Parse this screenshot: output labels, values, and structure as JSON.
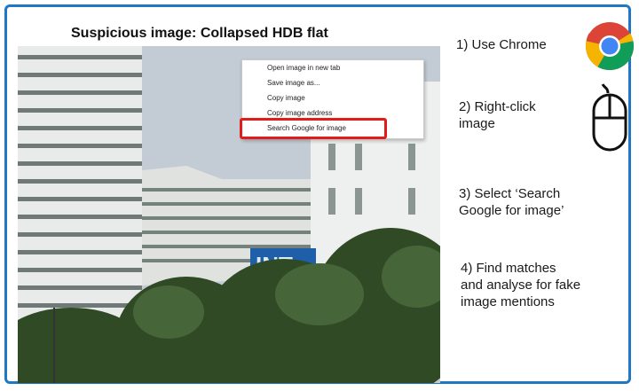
{
  "slide": {
    "title": "Suspicious image: Collapsed HDB flat"
  },
  "context_menu": {
    "items": [
      {
        "label": "Open image in new tab"
      },
      {
        "label": "Save image as..."
      },
      {
        "label": "Copy image"
      },
      {
        "label": "Copy image address"
      },
      {
        "label": "Search Google for image"
      }
    ],
    "highlighted_item": "Search Google for image",
    "highlight_color": "#e21b1b"
  },
  "photo": {
    "signage_text": "INT"
  },
  "steps": [
    {
      "text": "1)   Use Chrome"
    },
    {
      "text_line1": "2) Right-click",
      "text_line2": "image"
    },
    {
      "text_line1": "3) Select ‘Search",
      "text_line2": "Google for image’"
    },
    {
      "text_line1": "4) Find matches",
      "text_line2": "and analyse for fake",
      "text_line3": "image mentions"
    }
  ],
  "icons": {
    "chrome": "chrome-logo-icon",
    "mouse": "computer-mouse-icon"
  },
  "colors": {
    "frame_border": "#1f78c4",
    "chrome_red": "#db4437",
    "chrome_yellow": "#f4b400",
    "chrome_green": "#0f9d58",
    "chrome_blue": "#4285f4"
  }
}
